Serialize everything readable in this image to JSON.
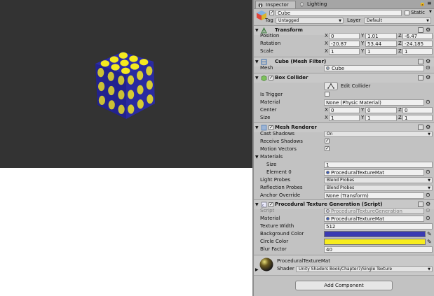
{
  "scene": {
    "cube": {
      "face_color": "#2b2ba8",
      "circle_color": "#f5e91e"
    }
  },
  "tabs": [
    {
      "label": "Inspector",
      "icon": "info-icon"
    },
    {
      "label": "Lighting",
      "icon": "bulb-icon"
    }
  ],
  "object": {
    "name": "Cube",
    "static_label": "Static",
    "tag_label": "Tag",
    "tag_value": "Untagged",
    "layer_label": "Layer",
    "layer_value": "Default"
  },
  "transform": {
    "title": "Transform",
    "rows": [
      {
        "label": "Position",
        "x": "0",
        "y": "1.01",
        "z": "-6.47"
      },
      {
        "label": "Rotation",
        "x": "-20.87",
        "y": "53.44",
        "z": "-24.185"
      },
      {
        "label": "Scale",
        "x": "1",
        "y": "1",
        "z": "1"
      }
    ]
  },
  "mesh_filter": {
    "title": "Cube (Mesh Filter)",
    "mesh_label": "Mesh",
    "mesh_value": "Cube"
  },
  "box_collider": {
    "title": "Box Collider",
    "edit_label": "Edit Collider",
    "trigger_label": "Is Trigger",
    "material_label": "Material",
    "material_value": "None (Physic Material)",
    "center_label": "Center",
    "center": {
      "x": "0",
      "y": "0",
      "z": "0"
    },
    "size_label": "Size",
    "size": {
      "x": "1",
      "y": "1",
      "z": "1"
    }
  },
  "mesh_renderer": {
    "title": "Mesh Renderer",
    "cast_label": "Cast Shadows",
    "cast_value": "On",
    "receive_label": "Receive Shadows",
    "motion_label": "Motion Vectors",
    "materials_label": "Materials",
    "size_label": "Size",
    "size_value": "1",
    "element_label": "Element 0",
    "element_value": "ProceduralTextureMat",
    "light_label": "Light Probes",
    "light_value": "Blend Probes",
    "reflection_label": "Reflection Probes",
    "reflection_value": "Blend Probes",
    "anchor_label": "Anchor Override",
    "anchor_value": "None (Transform)"
  },
  "script": {
    "title": "Procedural Texture Generation (Script)",
    "script_label": "Script",
    "script_value": "ProceduralTextureGeneration",
    "material_label": "Material",
    "material_value": "ProceduralTextureMat",
    "width_label": "Texture Width",
    "width_value": "512",
    "bg_label": "Background Color",
    "bg_color": "#3a3ab2",
    "circle_label": "Circle Color",
    "circle_color": "#f7ec1e",
    "blur_label": "Blur Factor",
    "blur_value": "40"
  },
  "material": {
    "name": "ProceduralTextureMat",
    "shader_label": "Shader",
    "shader_value": "Unity Shaders Book/Chapter7/Single Texture"
  },
  "add_component_label": "Add Component"
}
